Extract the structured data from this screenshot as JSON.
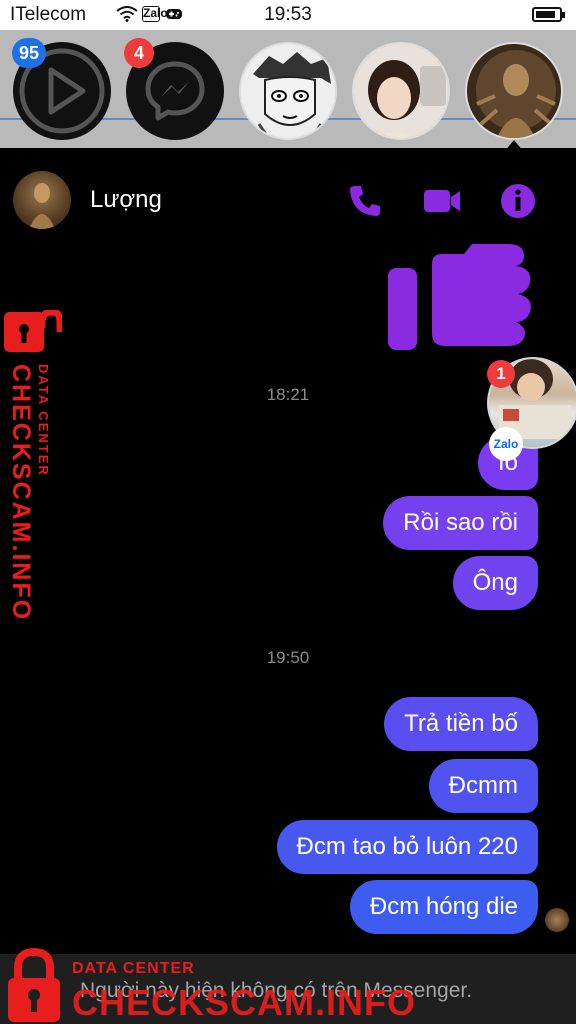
{
  "status_bar": {
    "carrier": "ITelecom",
    "time": "19:53",
    "battery_level": 0.85,
    "zalo_label": "Zalo"
  },
  "chat_heads": [
    {
      "name": "video-app",
      "badge": "95"
    },
    {
      "name": "messenger",
      "badge": "4"
    },
    {
      "name": "manga-avatar",
      "badge": ""
    },
    {
      "name": "girl-avatar",
      "badge": ""
    },
    {
      "name": "buddha-avatar",
      "badge": ""
    }
  ],
  "chat": {
    "contact_name": "Lượng",
    "messages": [
      {
        "type": "like_sticker"
      },
      {
        "type": "timestamp",
        "text": "18:21"
      },
      {
        "type": "out",
        "text": "Ìo"
      },
      {
        "type": "out",
        "text": "Rồi sao rồi"
      },
      {
        "type": "out",
        "text": "Ông"
      },
      {
        "type": "timestamp",
        "text": "19:50"
      },
      {
        "type": "out",
        "text": "Trả tiền bố"
      },
      {
        "type": "out",
        "text": "Đcmm"
      },
      {
        "type": "out",
        "text": "Đcm tao bỏ luôn 220"
      },
      {
        "type": "out",
        "text": "Đcm hóng die"
      }
    ],
    "footer_notice": "Người này hiện không có trên Messenger."
  },
  "zalo_bubble": {
    "badge": "1",
    "logo": "Zalo"
  },
  "watermark": {
    "title": "DATA CENTER",
    "brand": "CHECKSCAM.INFO"
  },
  "colors": {
    "accent": "#8a2be2",
    "bubble_top": "#7a3cf0",
    "bubble_bottom": "#3d5cf0"
  }
}
